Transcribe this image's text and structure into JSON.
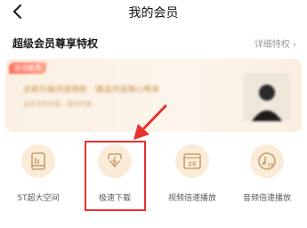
{
  "header": {
    "title": "我的会员"
  },
  "section": {
    "title": "超级会员尊享特权",
    "detail_link": "详细特权 ›"
  },
  "banner": {
    "tag": "活动推荐",
    "headline": "全新升级内容特权 · 精品内容随心畅享",
    "sub": "会员专享内容，限时开放"
  },
  "features": [
    {
      "label": "5T超大空间",
      "icon": "storage-icon"
    },
    {
      "label": "极速下载",
      "icon": "download-icon"
    },
    {
      "label": "视频倍速播放",
      "icon": "video-speed-icon"
    },
    {
      "label": "音频倍速播放",
      "icon": "audio-speed-icon"
    }
  ],
  "colors": {
    "accent": "#c9a06a",
    "highlight": "#e8322f",
    "icon_bg": "#fbecd9"
  }
}
